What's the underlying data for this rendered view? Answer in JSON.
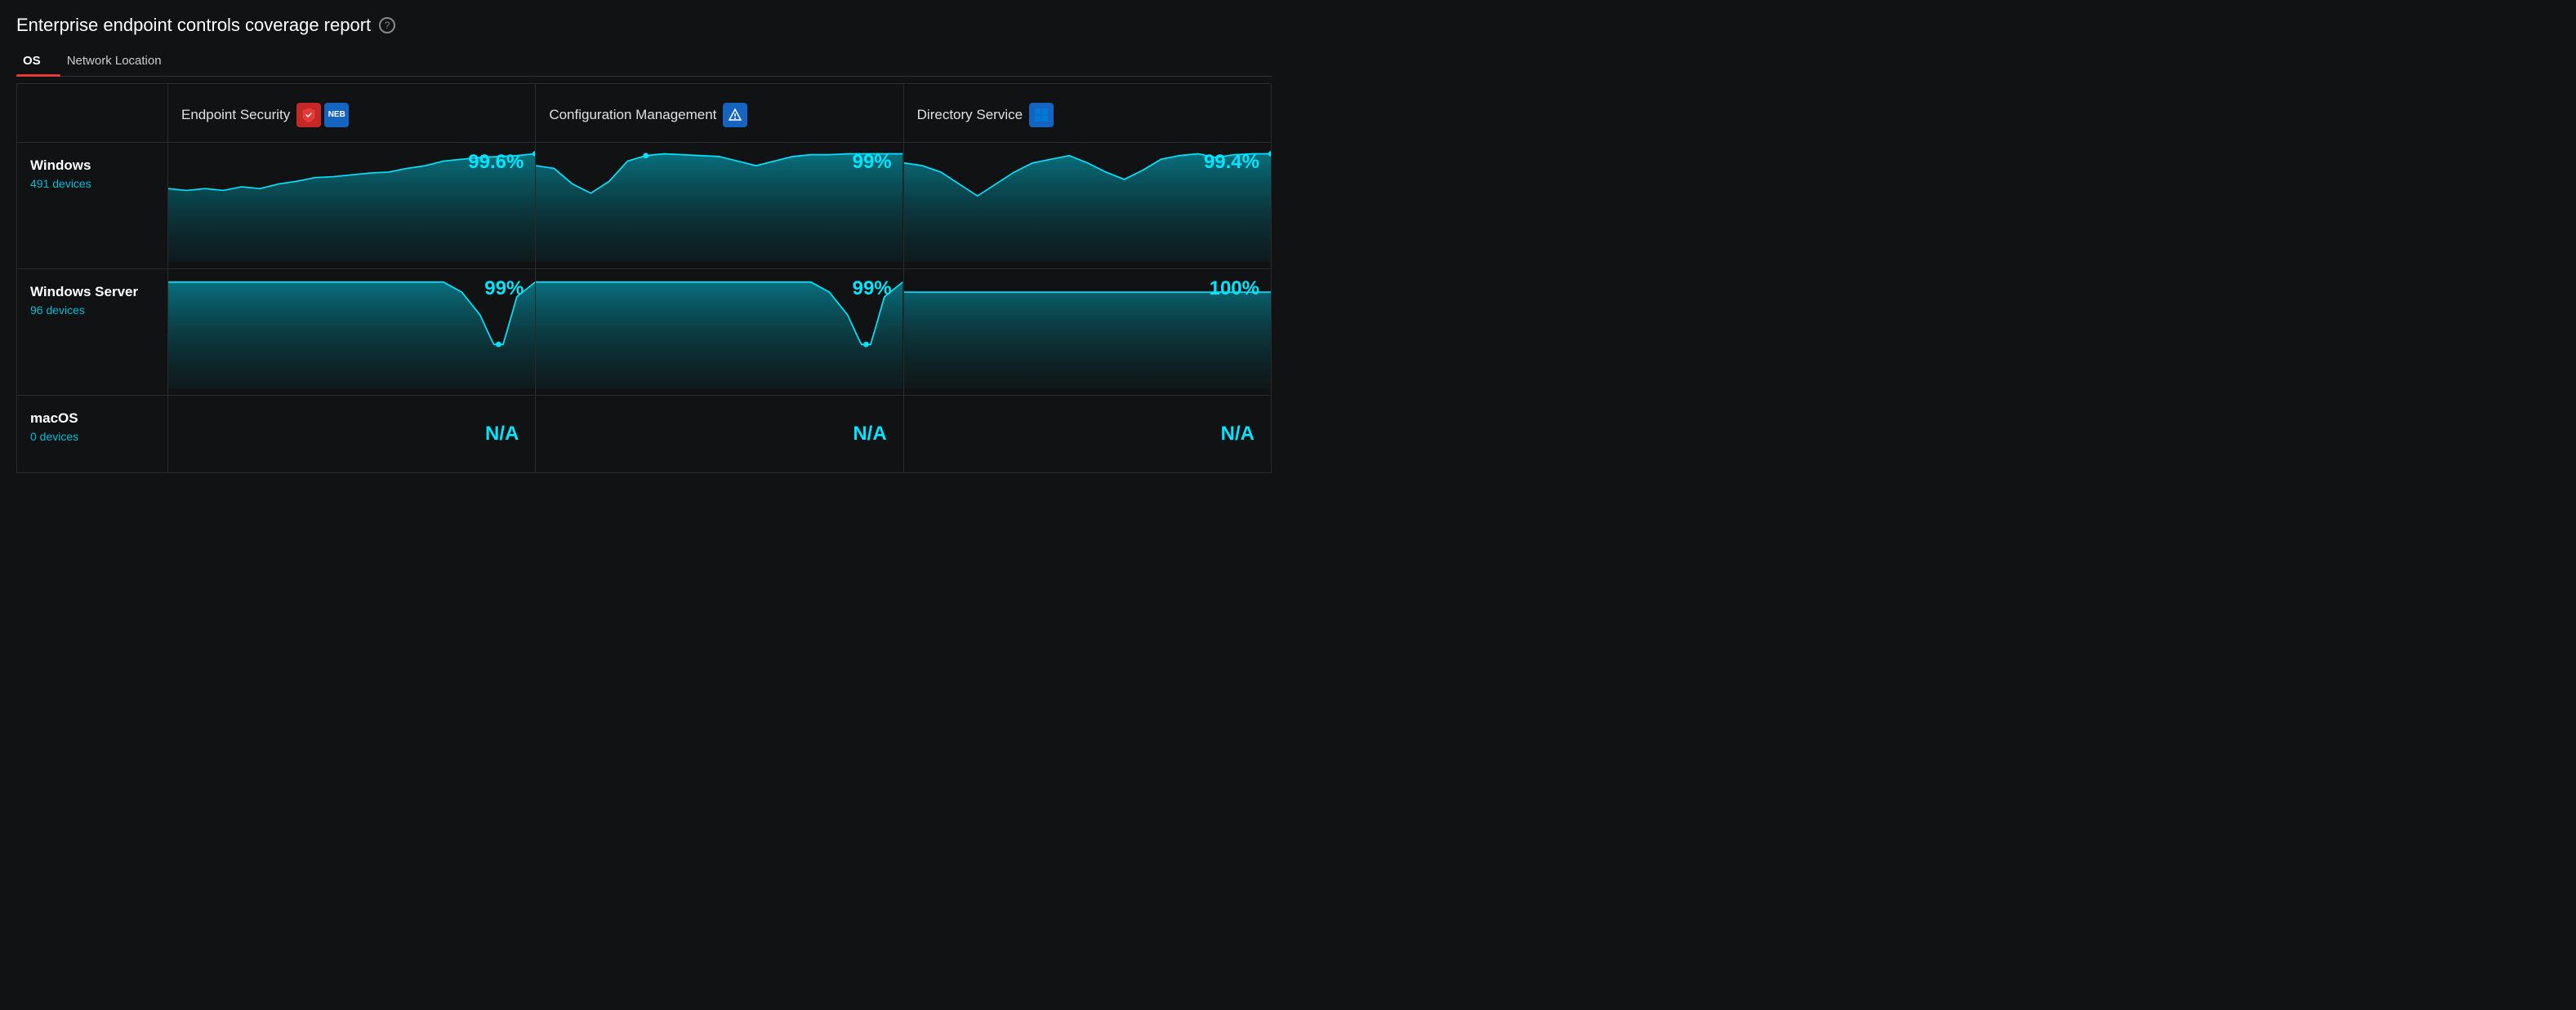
{
  "page": {
    "title": "Enterprise endpoint controls coverage report",
    "help_icon": "?",
    "tabs": [
      {
        "id": "os",
        "label": "OS",
        "active": true
      },
      {
        "id": "network-location",
        "label": "Network Location",
        "active": false
      }
    ]
  },
  "columns": [
    {
      "id": "endpoint-security",
      "label": "Endpoint Security",
      "icon": "endpoint-security-icon"
    },
    {
      "id": "configuration-management",
      "label": "Configuration Management",
      "icon": "configuration-management-icon"
    },
    {
      "id": "directory-service",
      "label": "Directory Service",
      "icon": "directory-service-icon"
    }
  ],
  "rows": [
    {
      "id": "windows",
      "label": "Windows",
      "sublabel": "491 devices",
      "values": [
        "99.6%",
        "99%",
        "99.4%"
      ],
      "na": false
    },
    {
      "id": "windows-server",
      "label": "Windows Server",
      "sublabel": "96 devices",
      "values": [
        "99%",
        "99%",
        "100%"
      ],
      "na": false
    },
    {
      "id": "macos",
      "label": "macOS",
      "sublabel": "0 devices",
      "values": [
        "N/A",
        "N/A",
        "N/A"
      ],
      "na": true
    }
  ],
  "charts": {
    "windows": {
      "endpoint_security": [
        0.92,
        0.91,
        0.92,
        0.91,
        0.93,
        0.92,
        0.94,
        0.95,
        0.96,
        0.96,
        0.97,
        0.97,
        0.97,
        0.98,
        0.98,
        0.99,
        0.99,
        0.99,
        0.99,
        0.996
      ],
      "config_mgmt": [
        0.97,
        0.96,
        0.9,
        0.87,
        0.9,
        0.95,
        0.98,
        0.99,
        0.99,
        0.99,
        0.99,
        0.98,
        0.97,
        0.96,
        0.97,
        0.98,
        0.99,
        0.99,
        0.99,
        0.99
      ],
      "directory_service": [
        0.97,
        0.96,
        0.94,
        0.91,
        0.88,
        0.92,
        0.95,
        0.97,
        0.98,
        0.99,
        0.97,
        0.95,
        0.93,
        0.95,
        0.97,
        0.98,
        0.99,
        0.994,
        0.99,
        0.994
      ]
    },
    "windows_server": {
      "endpoint_security": [
        0.99,
        0.99,
        0.99,
        0.99,
        0.99,
        0.99,
        0.99,
        0.99,
        0.99,
        0.99,
        0.99,
        0.99,
        0.99,
        0.99,
        0.99,
        0.95,
        0.85,
        0.75,
        0.72,
        0.99
      ],
      "config_mgmt": [
        0.99,
        0.99,
        0.99,
        0.99,
        0.99,
        0.99,
        0.99,
        0.99,
        0.99,
        0.99,
        0.99,
        0.99,
        0.99,
        0.99,
        0.99,
        0.95,
        0.85,
        0.75,
        0.72,
        0.99
      ],
      "directory_service": [
        1.0,
        1.0,
        1.0,
        1.0,
        1.0,
        1.0,
        1.0,
        1.0,
        1.0,
        1.0,
        1.0,
        1.0,
        1.0,
        1.0,
        1.0,
        1.0,
        1.0,
        1.0,
        1.0,
        1.0
      ]
    }
  },
  "colors": {
    "background": "#111213",
    "accent_cyan": "#00e5ff",
    "border": "#2a2a2a",
    "chart_stroke": "#00bcd4",
    "chart_fill_top": "rgba(0,188,212,0.5)",
    "chart_fill_bottom": "rgba(0,77,86,0.1)"
  }
}
